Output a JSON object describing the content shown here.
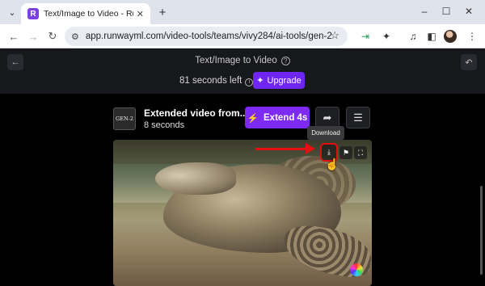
{
  "browser": {
    "tab_title": "Text/Image to Video - Runway",
    "tab_close": "✕",
    "new_tab": "+",
    "url": "app.runwayml.com/video-tools/teams/vivy284/ai-tools/gen-2",
    "window_controls": [
      "–",
      "☐",
      "✕"
    ],
    "icons": [
      "tab-search-icon",
      "back-icon",
      "forward-icon",
      "reload-icon",
      "site-info-icon",
      "bookmark-star-icon",
      "extension-icon",
      "puzzle-icon",
      "media-icon",
      "sidebar-icon",
      "profile-avatar",
      "menu-icon"
    ]
  },
  "app": {
    "page_title": "Text/Image to Video",
    "seconds_left": "81 seconds left",
    "upgrade_label": "Upgrade",
    "video": {
      "thumb_label": "GEN-2",
      "title": "Extended video from...",
      "duration": "8 seconds",
      "extend_label": "Extend 4s"
    },
    "tooltip": "Download",
    "colors": {
      "accent": "#7d2af4",
      "header_bg": "#17181c",
      "annotation_red": "#e21010"
    }
  }
}
